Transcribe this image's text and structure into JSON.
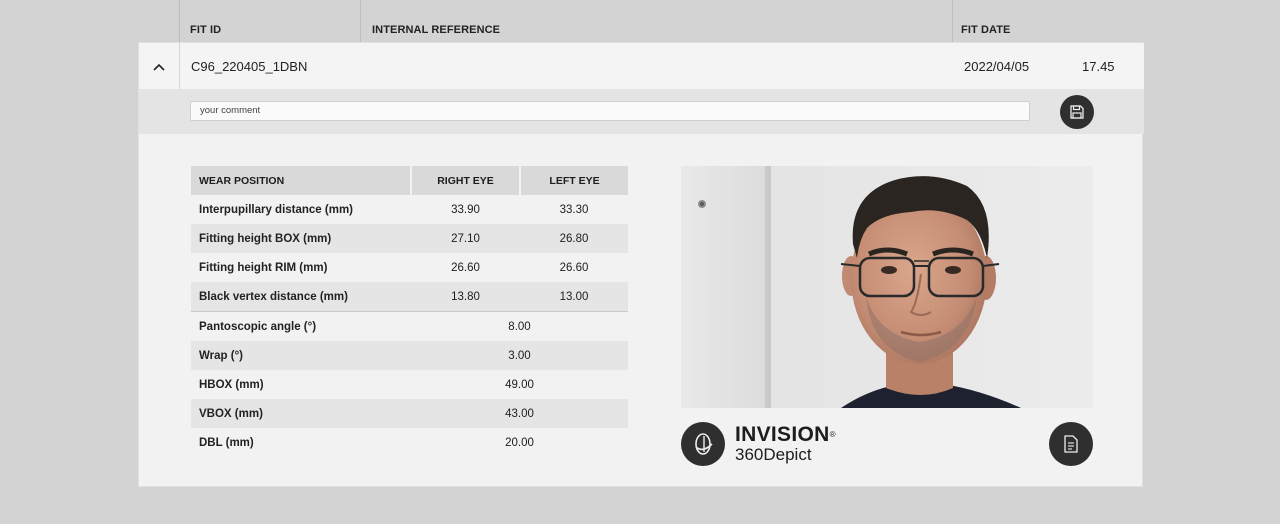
{
  "header": {
    "fit_id_label": "FIT ID",
    "internal_reference_label": "INTERNAL REFERENCE",
    "fit_date_label": "FIT DATE"
  },
  "fit": {
    "id": "C96_220405_1DBN",
    "date": "2022/04/05",
    "time": "17.45"
  },
  "comment": {
    "placeholder": "your comment"
  },
  "table": {
    "headers": [
      "WEAR POSITION",
      "RIGHT EYE",
      "LEFT EYE"
    ],
    "rows_both": [
      {
        "label": "Interpupillary distance (mm)",
        "right": "33.90",
        "left": "33.30"
      },
      {
        "label": "Fitting height BOX (mm)",
        "right": "27.10",
        "left": "26.80"
      },
      {
        "label": "Fitting height RIM (mm)",
        "right": "26.60",
        "left": "26.60"
      },
      {
        "label": "Black vertex distance (mm)",
        "right": "13.80",
        "left": "13.00"
      }
    ],
    "rows_single": [
      {
        "label": "Pantoscopic angle (°)",
        "value": "8.00"
      },
      {
        "label": "Wrap (°)",
        "value": "3.00"
      },
      {
        "label": "HBOX (mm)",
        "value": "49.00"
      },
      {
        "label": "VBOX (mm)",
        "value": "43.00"
      },
      {
        "label": "DBL (mm)",
        "value": "20.00"
      }
    ]
  },
  "brand": {
    "name": "INVISION",
    "registered": "®",
    "product": "360Depict"
  },
  "icons": {
    "chevron": "chevron-up-icon",
    "save": "save-icon",
    "logo": "invision-360-logo-icon",
    "report": "document-icon"
  },
  "colors": {
    "page_bg": "#d3d3d3",
    "card_bg": "#f2f2f2",
    "comment_bar": "#e4e4e4",
    "header_cell": "#d9d9d9",
    "dark_button": "#2f2f2f"
  }
}
